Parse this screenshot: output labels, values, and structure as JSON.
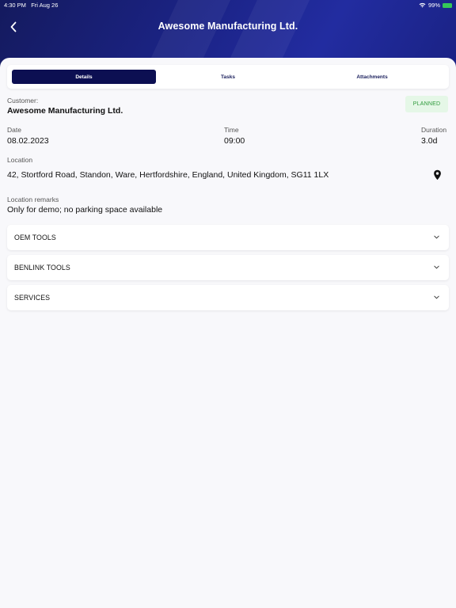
{
  "status_bar": {
    "time": "4:30 PM",
    "date": "Fri Aug 26",
    "battery": "99%"
  },
  "header": {
    "title": "Awesome Manufacturing Ltd.",
    "back_icon": "chevron-left-icon"
  },
  "tabs": [
    {
      "label": "Details",
      "active": true
    },
    {
      "label": "Tasks",
      "active": false
    },
    {
      "label": "Attachments",
      "active": false
    }
  ],
  "details": {
    "customer_label": "Customer:",
    "customer_value": "Awesome Manufacturing Ltd.",
    "status_badge": "PLANNED",
    "date_label": "Date",
    "date_value": "08.02.2023",
    "time_label": "Time",
    "time_value": "09:00",
    "duration_label": "Duration",
    "duration_value": "3.0d",
    "location_label": "Location",
    "location_value": "42, Stortford Road, Standon, Ware, Hertfordshire, England, United Kingdom, SG11 1LX",
    "location_icon": "map-pin-icon",
    "remarks_label": "Location remarks",
    "remarks_value": "Only for demo; no parking space available"
  },
  "sections": [
    {
      "label": "OEM TOOLS",
      "icon": "chevron-down-icon"
    },
    {
      "label": "BENLINK TOOLS",
      "icon": "chevron-down-icon"
    },
    {
      "label": "SERVICES",
      "icon": "chevron-down-icon"
    }
  ],
  "colors": {
    "header_bg": "#1c2489",
    "active_tab": "#0c0f52",
    "badge_bg": "#e5f7e7",
    "badge_text": "#2e9a3b"
  }
}
